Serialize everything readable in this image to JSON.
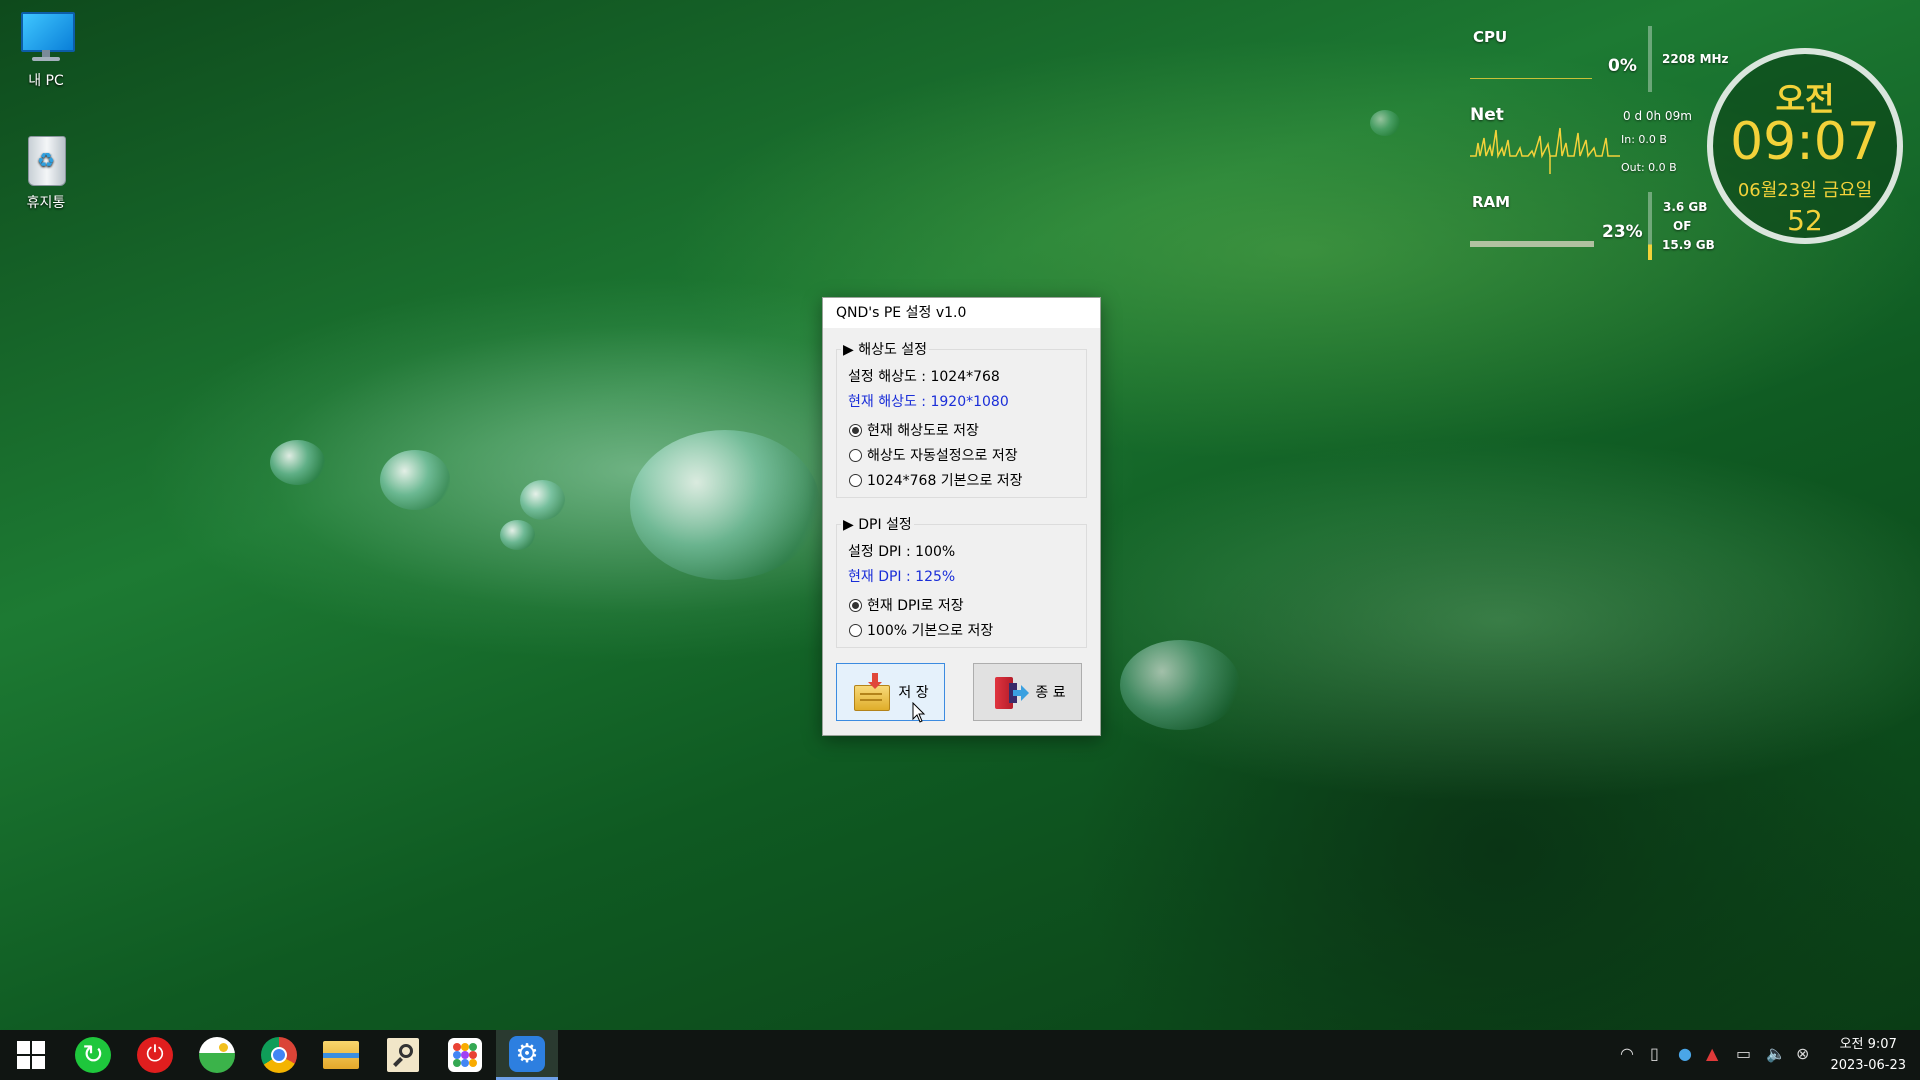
{
  "desktop": {
    "icons": [
      {
        "label": "내 PC",
        "icon": "monitor-icon"
      },
      {
        "label": "휴지통",
        "icon": "recycle-bin-icon"
      }
    ]
  },
  "monitor": {
    "cpu": {
      "label": "CPU",
      "percent": "0%",
      "freq": "2208 MHz"
    },
    "net": {
      "label": "Net",
      "uptime": "0 d 0h 09m",
      "in": "In: 0.0 B",
      "out": "Out: 0.0 B"
    },
    "ram": {
      "label": "RAM",
      "percent": "23%",
      "used": "3.6 GB",
      "of": "OF",
      "total": "15.9 GB"
    }
  },
  "clock_widget": {
    "ampm": "오전",
    "time": "09:07",
    "date": "06월23일 금요일",
    "seconds": "52"
  },
  "dialog": {
    "title": "QND's PE 설정 v1.0",
    "resolution": {
      "group_title": "▶ 해상도 설정",
      "set_value": "설정 해상도 : 1024*768",
      "current_value": "현재 해상도 : 1920*1080",
      "options": [
        {
          "label": "현재 해상도로 저장",
          "selected": true
        },
        {
          "label": "해상도 자동설정으로 저장",
          "selected": false
        },
        {
          "label": "1024*768 기본으로 저장",
          "selected": false
        }
      ]
    },
    "dpi": {
      "group_title": "▶ DPI 설정",
      "set_value": "설정 DPI : 100%",
      "current_value": "현재 DPI : 125%",
      "options": [
        {
          "label": "현재 DPI로 저장",
          "selected": true
        },
        {
          "label": "100% 기본으로 저장",
          "selected": false
        }
      ]
    },
    "save_label": "저 장",
    "quit_label": "종 료"
  },
  "taskbar": {
    "items": [
      "start-icon",
      "refresh-icon",
      "power-icon",
      "photos-icon",
      "chrome-icon",
      "file-explorer-icon",
      "search-tool-icon",
      "apps-grid-icon",
      "settings-icon"
    ],
    "clock_time": "오전 9:07",
    "clock_date": "2023-06-23"
  },
  "colors": {
    "accent_blue": "#1a2ed8",
    "widget_yellow": "#f3d23a",
    "taskbar": "#101512"
  }
}
